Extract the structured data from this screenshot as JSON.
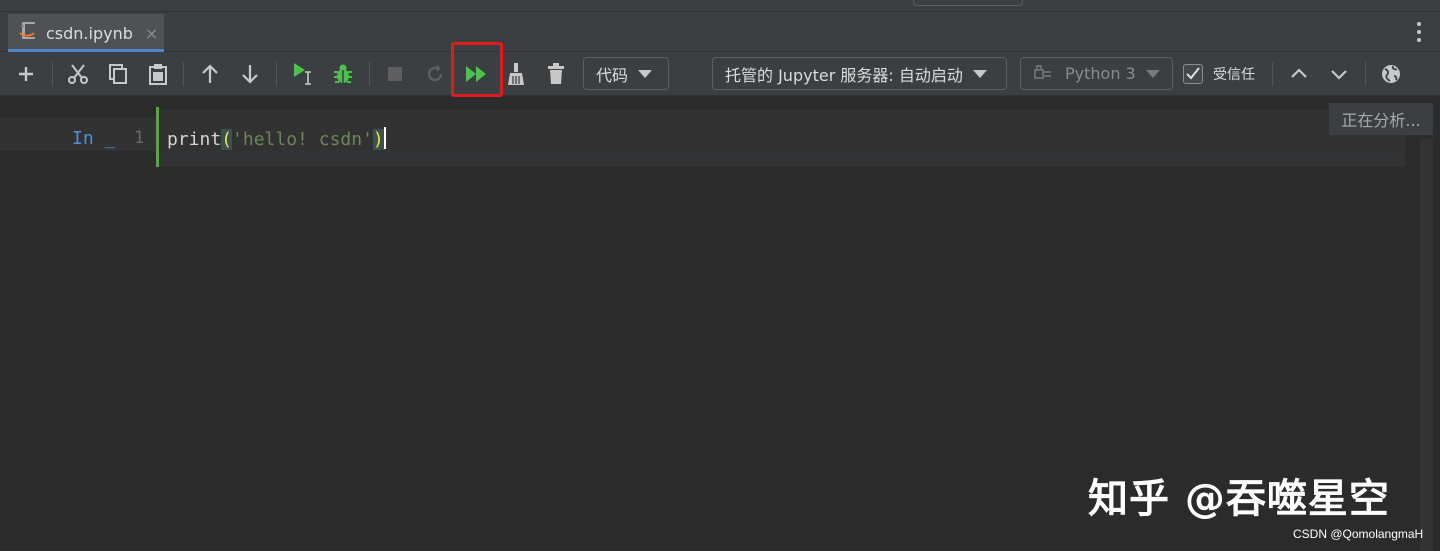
{
  "tab": {
    "label": "csdn.ipynb",
    "close": "×",
    "accent": "#4a88c7"
  },
  "toolbar": {
    "cell_type": "代码",
    "server": "托管的 Jupyter 服务器: 自动启动",
    "kernel": "Python 3",
    "trusted_label": "受信任",
    "trusted_checked": true,
    "highlight_color": "#e01b1b"
  },
  "editor": {
    "prompt": "In _",
    "line_number": "1",
    "code": {
      "fn": "print",
      "open": "(",
      "string": "'hello! csdn'",
      "close": ")"
    },
    "status": "正在分析..."
  },
  "watermark": {
    "text": "知乎 @吞噬星空",
    "credit": "CSDN @QomolangmaH"
  }
}
